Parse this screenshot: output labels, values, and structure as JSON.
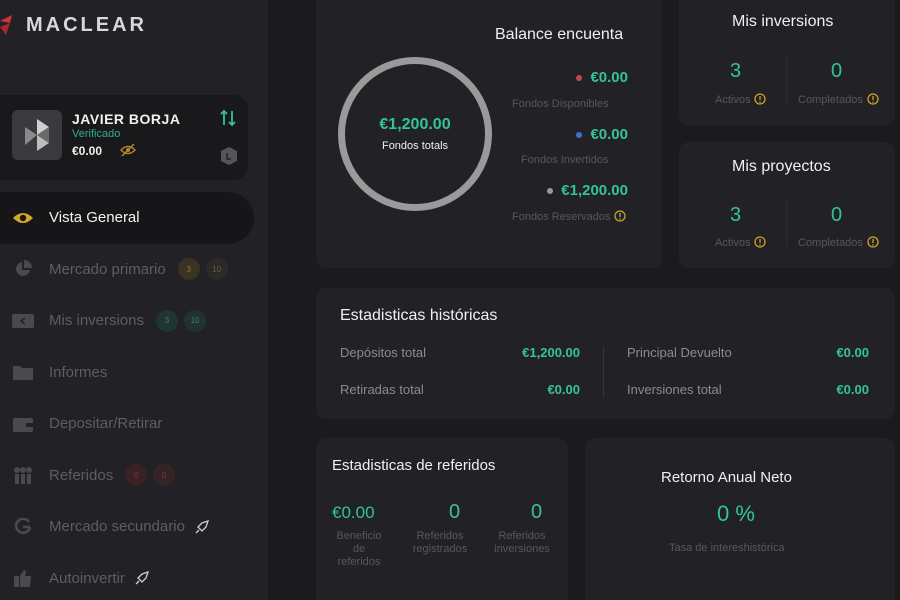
{
  "brand": {
    "name": "MACLEAR"
  },
  "user": {
    "name": "JAVIER BORJA",
    "status": "Verificado",
    "balance": "€0.00"
  },
  "nav": {
    "items": [
      {
        "label": "Vista General"
      },
      {
        "label": "Mercado primario",
        "badges": [
          "3",
          "10"
        ]
      },
      {
        "label": "Mis inversions",
        "badges": [
          "3",
          "10"
        ]
      },
      {
        "label": "Informes"
      },
      {
        "label": "Depositar/Retirar"
      },
      {
        "label": "Referidos",
        "badges": [
          "0",
          "0"
        ]
      },
      {
        "label": "Mercado secundario"
      },
      {
        "label": "Autoinvertir"
      }
    ]
  },
  "balance": {
    "title": "Balance encuenta",
    "total_amount": "€1,200.00",
    "total_label": "Fondos totals",
    "funds": [
      {
        "amount": "€0.00",
        "label": "Fondos Disponibles",
        "dot_color": "#c0484e"
      },
      {
        "amount": "€0.00",
        "label": "Fondos Invertidos",
        "dot_color": "#3f6fd1"
      },
      {
        "amount": "€1,200.00",
        "label": "Fondos Reservados",
        "dot_color": "#9a9a9a"
      }
    ]
  },
  "investments": {
    "title": "Mis inversions",
    "active": "3",
    "active_label": "Activos",
    "completed": "0",
    "completed_label": "Completados"
  },
  "projects": {
    "title": "Mis proyectos",
    "active": "3",
    "active_label": "Activos",
    "completed": "0",
    "completed_label": "Completados"
  },
  "historic": {
    "title": "Estadisticas históricas",
    "rows": [
      {
        "label": "Depósitos total",
        "value": "€1,200.00"
      },
      {
        "label": "Retiradas total",
        "value": "€0.00"
      },
      {
        "label": "Principal Devuelto",
        "value": "€0.00"
      },
      {
        "label": "Inversiones total",
        "value": "€0.00"
      }
    ]
  },
  "referrals": {
    "title": "Estadisticas de referidos",
    "benefit": "€0.00",
    "benefit_label_1": "Beneficio",
    "benefit_label_2": "de",
    "benefit_label_3": "referidos",
    "registered": "0",
    "registered_label_1": "Referidos",
    "registered_label_2": "registrados",
    "investments": "0",
    "investments_label_1": "Referidos",
    "investments_label_2": "inversiones"
  },
  "annual": {
    "title": "Retorno Anual Neto",
    "value": "0 %",
    "caption": "Tasa de intereshistórica"
  },
  "colors": {
    "accent": "#33c495",
    "background": "#1b1b1e",
    "card": "#222226",
    "muted": "#58585c",
    "warning": "#c9a227"
  }
}
